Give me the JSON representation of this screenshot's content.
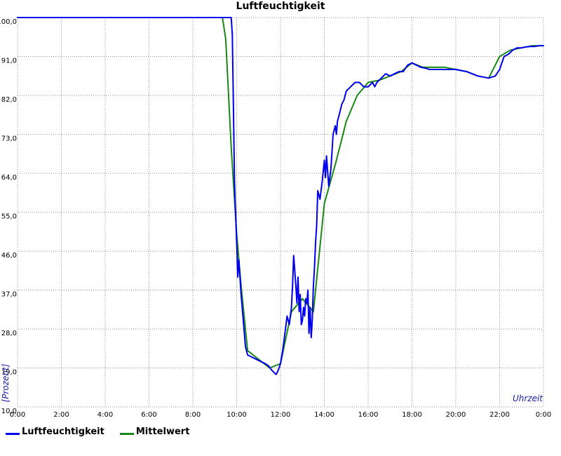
{
  "chart_data": {
    "type": "line",
    "title": "Luftfeuchtigkeit",
    "xlabel": "Uhrzeit",
    "ylabel": "[Prozent]",
    "x_ticks": [
      "0:00",
      "2:00",
      "4:00",
      "6:00",
      "8:00",
      "10:00",
      "12:00",
      "14:00",
      "16:00",
      "18:00",
      "20:00",
      "22:00",
      "0:00"
    ],
    "y_ticks": [
      "10,0",
      "19,0",
      "28,0",
      "37,0",
      "46,0",
      "55,0",
      "64,0",
      "73,0",
      "82,0",
      "91,0",
      "100,0"
    ],
    "xlim": [
      0,
      24
    ],
    "ylim": [
      10,
      100
    ],
    "grid": true,
    "legend_position": "bottom-left",
    "series": [
      {
        "name": "Luftfeuchtigkeit",
        "color": "#0000ee",
        "x": [
          0,
          9.7,
          9.75,
          9.8,
          9.85,
          9.9,
          9.95,
          10.0,
          10.05,
          10.1,
          10.2,
          10.3,
          10.4,
          10.5,
          10.7,
          10.9,
          11.1,
          11.3,
          11.45,
          11.6,
          11.7,
          11.8,
          11.9,
          12.0,
          12.1,
          12.2,
          12.3,
          12.4,
          12.5,
          12.55,
          12.6,
          12.7,
          12.75,
          12.8,
          12.85,
          12.9,
          12.95,
          13.0,
          13.05,
          13.1,
          13.15,
          13.2,
          13.25,
          13.3,
          13.35,
          13.4,
          13.45,
          13.5,
          13.55,
          13.6,
          13.65,
          13.7,
          13.75,
          13.8,
          13.9,
          14.0,
          14.05,
          14.1,
          14.2,
          14.3,
          14.4,
          14.5,
          14.55,
          14.6,
          14.7,
          14.8,
          14.9,
          15.0,
          15.2,
          15.4,
          15.6,
          15.8,
          16.0,
          16.2,
          16.3,
          16.4,
          16.6,
          16.8,
          17.0,
          17.2,
          17.4,
          17.6,
          17.8,
          18.0,
          18.2,
          18.4,
          18.6,
          18.8,
          19.0,
          19.5,
          20.0,
          20.5,
          21.0,
          21.5,
          21.8,
          22.0,
          22.2,
          22.4,
          22.6,
          22.8,
          23.0,
          23.2,
          23.4,
          23.6,
          23.8,
          24.0
        ],
        "values": [
          100,
          100,
          100,
          96,
          80,
          62,
          55,
          48,
          40,
          44,
          36,
          30,
          24,
          22,
          21.5,
          21,
          20.5,
          20,
          19.5,
          18.5,
          18,
          17.5,
          18.5,
          20,
          23,
          27,
          31,
          29,
          33,
          38,
          45,
          38,
          34,
          40,
          32,
          36,
          29,
          30,
          33,
          31,
          35,
          34,
          37,
          27,
          33,
          26,
          30,
          38,
          42,
          48,
          52,
          60,
          59,
          58,
          62,
          67,
          63,
          68,
          61,
          65,
          73,
          75,
          73,
          76,
          78,
          80,
          81,
          83,
          84,
          85,
          85,
          84,
          84,
          85,
          84,
          85,
          86,
          87,
          86.5,
          87,
          87.5,
          87.5,
          89,
          89.5,
          89,
          88.5,
          88.3,
          88,
          88,
          88,
          88,
          87.5,
          86.5,
          86,
          86.5,
          88,
          91,
          91.5,
          92.5,
          93,
          93,
          93.2,
          93.3,
          93.3,
          93.5,
          93.5
        ]
      },
      {
        "name": "Mittelwert",
        "color": "#168816",
        "x": [
          0,
          9.35,
          9.5,
          9.75,
          10.0,
          10.2,
          10.5,
          11.0,
          11.5,
          12.0,
          12.5,
          13.0,
          13.5,
          14.0,
          14.5,
          15.0,
          15.5,
          16.0,
          16.5,
          17.0,
          17.5,
          18.0,
          18.5,
          19.0,
          19.5,
          20.0,
          20.5,
          21.0,
          21.5,
          22.0,
          22.5,
          23.0,
          23.5,
          24.0
        ],
        "values": [
          100,
          100,
          95,
          70,
          50,
          38,
          23,
          21,
          19,
          20,
          32,
          35,
          32,
          57,
          66,
          76,
          82,
          85,
          85.5,
          86.5,
          87.5,
          89.5,
          88.5,
          88.5,
          88.5,
          88,
          87.5,
          86.5,
          86,
          91,
          92.5,
          93,
          93.5,
          93.5
        ]
      }
    ]
  }
}
